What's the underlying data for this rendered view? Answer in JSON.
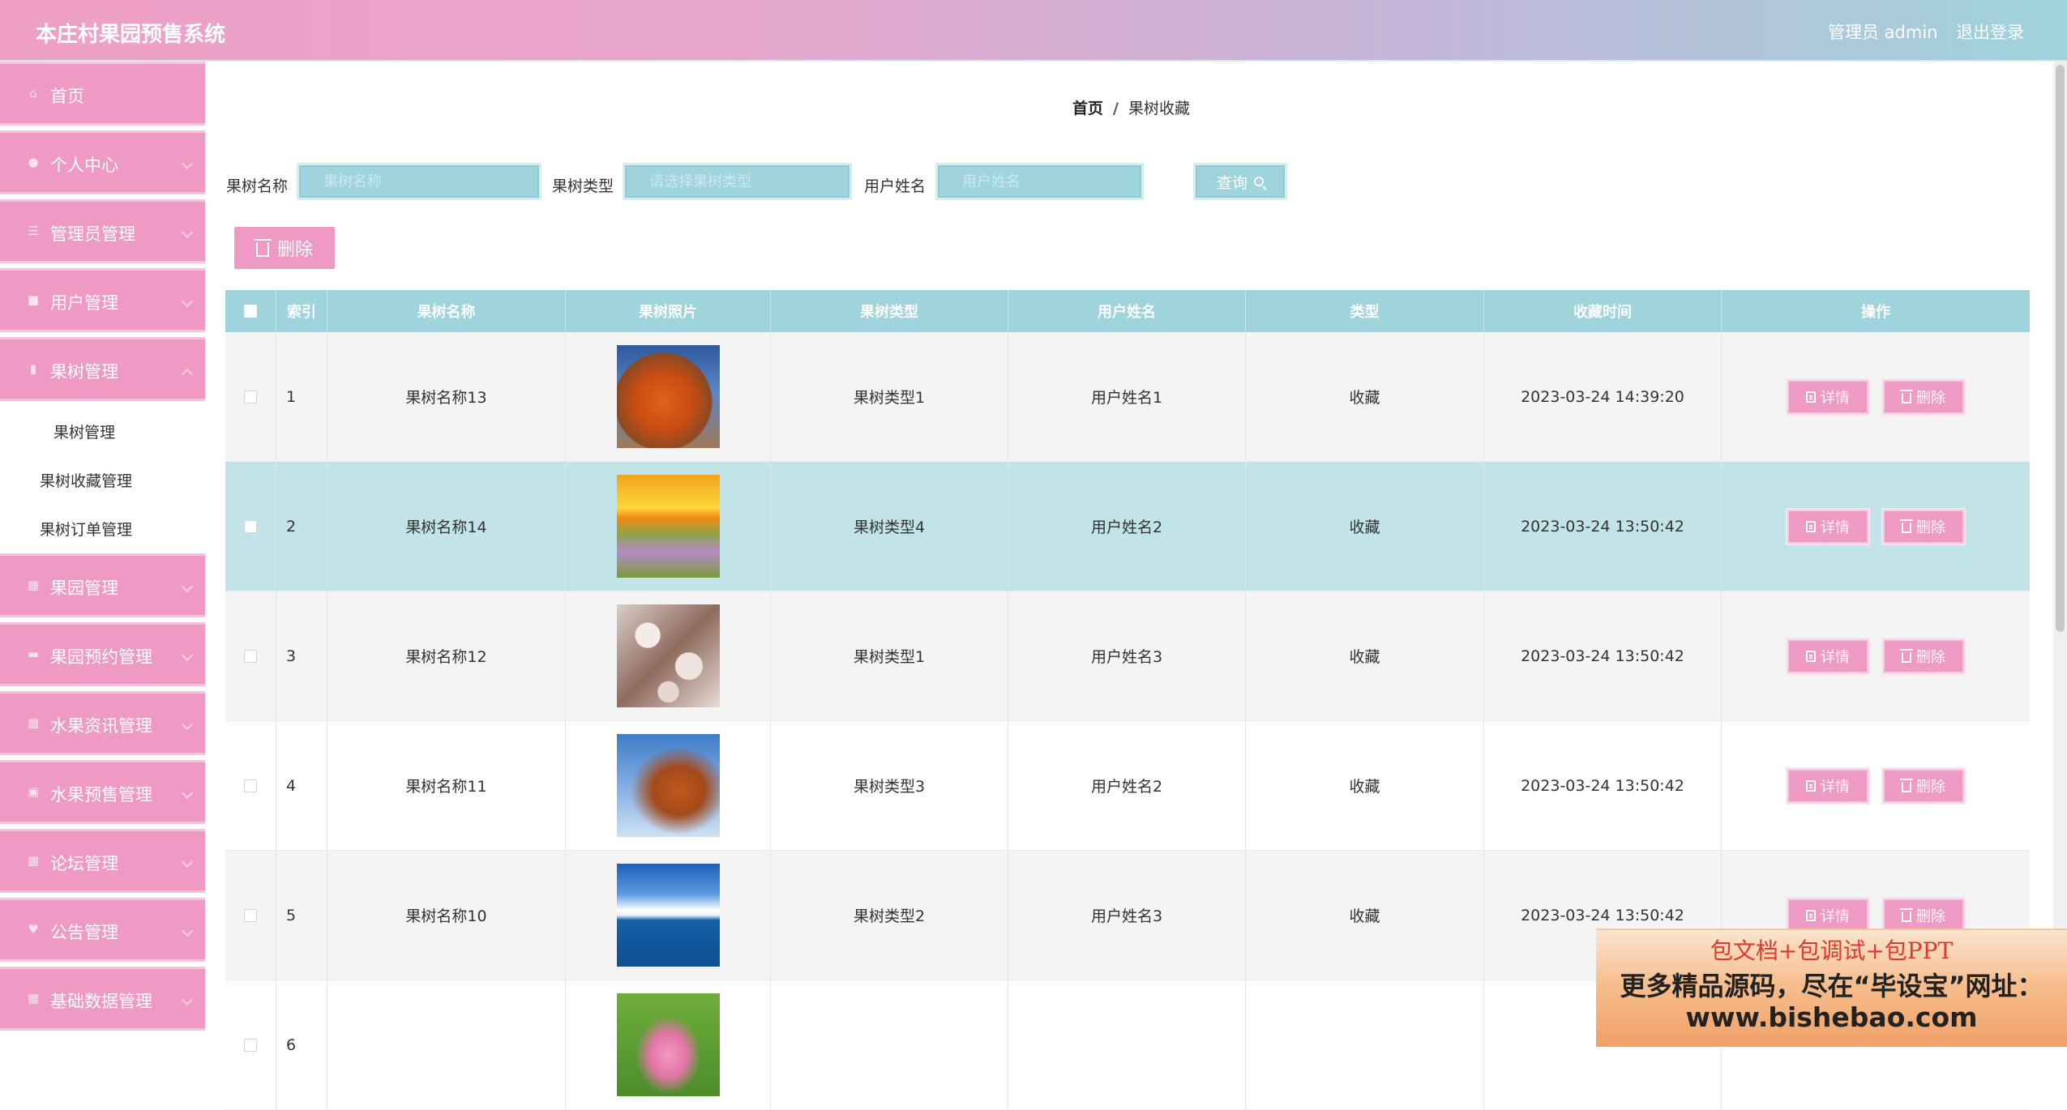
{
  "header": {
    "title": "本庄村果园预售系统",
    "user": "管理员 admin",
    "logout": "退出登录"
  },
  "sidebar": {
    "items": [
      {
        "label": "首页",
        "icon": "home-icon"
      },
      {
        "label": "个人中心",
        "icon": "user-icon"
      },
      {
        "label": "管理员管理",
        "icon": "list-icon"
      },
      {
        "label": "用户管理",
        "icon": "users-icon"
      },
      {
        "label": "果树管理",
        "icon": "chart-icon"
      },
      {
        "label": "果园管理",
        "icon": "grid-icon"
      },
      {
        "label": "果园预约管理",
        "icon": "monitor-icon"
      },
      {
        "label": "水果资讯管理",
        "icon": "grid-icon"
      },
      {
        "label": "水果预售管理",
        "icon": "box-icon"
      },
      {
        "label": "论坛管理",
        "icon": "grid-icon"
      },
      {
        "label": "公告管理",
        "icon": "bell-icon"
      },
      {
        "label": "基础数据管理",
        "icon": "grid-icon"
      }
    ],
    "sub_items": [
      "果树管理",
      "果树收藏管理",
      "果树订单管理"
    ]
  },
  "breadcrumb": {
    "home": "首页",
    "sep": "/",
    "current": "果树收藏"
  },
  "filters": {
    "name_label": "果树名称",
    "name_placeholder": "果树名称",
    "type_label": "果树类型",
    "type_placeholder": "请选择果树类型",
    "user_label": "用户姓名",
    "user_placeholder": "用户姓名",
    "search_label": "查询"
  },
  "toolbar": {
    "delete_label": "删除"
  },
  "table": {
    "columns": [
      "索引",
      "果树名称",
      "果树照片",
      "果树类型",
      "用户姓名",
      "类型",
      "收藏时间",
      "操作"
    ],
    "detail_label": "详情",
    "delete_label": "删除",
    "rows": [
      {
        "index": "1",
        "name": "果树名称13",
        "type": "果树类型1",
        "user": "用户姓名1",
        "kind": "收藏",
        "time": "2023-03-24 14:39:20",
        "photo": "orange rock"
      },
      {
        "index": "2",
        "name": "果树名称14",
        "type": "果树类型4",
        "user": "用户姓名2",
        "kind": "收藏",
        "time": "2023-03-24 13:50:42",
        "photo": "sunset meadow"
      },
      {
        "index": "3",
        "name": "果树名称12",
        "type": "果树类型1",
        "user": "用户姓名3",
        "kind": "收藏",
        "time": "2023-03-24 13:50:42",
        "photo": "blossom branch"
      },
      {
        "index": "4",
        "name": "果树名称11",
        "type": "果树类型3",
        "user": "用户姓名2",
        "kind": "收藏",
        "time": "2023-03-24 13:50:42",
        "photo": "autumn leaves"
      },
      {
        "index": "5",
        "name": "果树名称10",
        "type": "果树类型2",
        "user": "用户姓名3",
        "kind": "收藏",
        "time": "2023-03-24 13:50:42",
        "photo": "sea and sky"
      },
      {
        "index": "6",
        "name": "",
        "type": "",
        "user": "",
        "kind": "",
        "time": "",
        "photo": "lotus flower"
      }
    ]
  },
  "watermark": {
    "line1": "包文档+包调试+包PPT",
    "line2": "更多精品源码，尽在“毕设宝”网址：",
    "line3": "www.bishebao.com"
  },
  "colors": {
    "accent_pink": "#ef9ac4",
    "accent_teal": "#9fd4dc",
    "highlight_row": "#c2e3e7"
  }
}
